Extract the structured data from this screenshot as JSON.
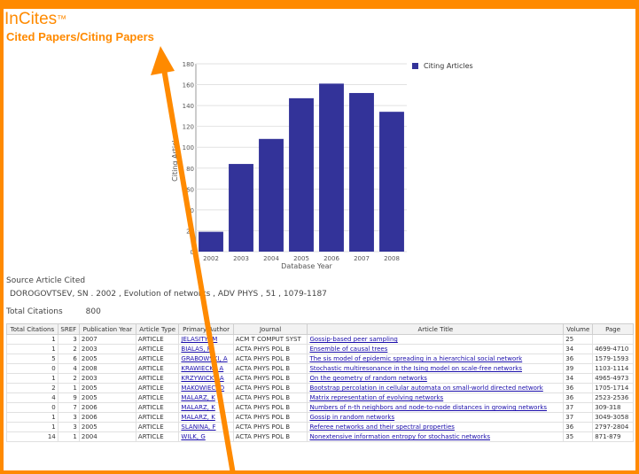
{
  "header": {
    "brand": "InCites",
    "brand_mark": "™",
    "subtitle": "Cited Papers/Citing Papers"
  },
  "chart_data": {
    "type": "bar",
    "categories": [
      "2002",
      "2003",
      "2004",
      "2005",
      "2006",
      "2007",
      "2008"
    ],
    "values": [
      19,
      84,
      108,
      147,
      161,
      152,
      134
    ],
    "ylabel": "Citing Articles",
    "xlabel": "Database Year",
    "yticks": [
      "180",
      "160",
      "140",
      "120",
      "100",
      "80",
      "60",
      "40",
      "20",
      "0"
    ],
    "ylim": [
      0,
      180
    ],
    "legend": "Citing Articles",
    "bar_color": "#333399"
  },
  "source": {
    "heading": "Source Article Cited",
    "line": "DOROGOVTSEV, SN .  2002 ,   Evolution of networks ,   ADV PHYS ,   51 ,   1079-1187",
    "total_label": "Total Citations",
    "total_value": "800"
  },
  "table": {
    "headers": [
      "Total Citations",
      "SREF",
      "Publication Year",
      "Article Type",
      "Primary Author",
      "Journal",
      "Article Title",
      "Volume",
      "Page"
    ],
    "rows": [
      [
        "1",
        "3",
        "2007",
        "ARTICLE",
        "JELASITY, M",
        "ACM T COMPUT SYST",
        "Gossip-based peer sampling",
        "25",
        ""
      ],
      [
        "1",
        "2",
        "2003",
        "ARTICLE",
        "BIALAS, P",
        "ACTA PHYS POL B",
        "Ensemble of causal trees",
        "34",
        "4699-4710"
      ],
      [
        "5",
        "6",
        "2005",
        "ARTICLE",
        "GRABOWSKI, A",
        "ACTA PHYS POL B",
        "The sis model of epidemic spreading in a hierarchical social network",
        "36",
        "1579-1593"
      ],
      [
        "0",
        "4",
        "2008",
        "ARTICLE",
        "KRAWIECKI, A",
        "ACTA PHYS POL B",
        "Stochastic multiresonance in the Ising model on scale-free networks",
        "39",
        "1103-1114"
      ],
      [
        "1",
        "2",
        "2003",
        "ARTICLE",
        "KRZYWICKI, A",
        "ACTA PHYS POL B",
        "On the geometry of random networks",
        "34",
        "4965-4973"
      ],
      [
        "2",
        "1",
        "2005",
        "ARTICLE",
        "MAKOWIEC, D",
        "ACTA PHYS POL B",
        "Bootstrap percolation in cellular automata on small-world directed network",
        "36",
        "1705-1714"
      ],
      [
        "4",
        "9",
        "2005",
        "ARTICLE",
        "MALARZ, K",
        "ACTA PHYS POL B",
        "Matrix representation of evolving networks",
        "36",
        "2523-2536"
      ],
      [
        "0",
        "7",
        "2006",
        "ARTICLE",
        "MALARZ, K",
        "ACTA PHYS POL B",
        "Numbers of n-th neighbors and node-to-node distances in growing networks",
        "37",
        "309-318"
      ],
      [
        "1",
        "3",
        "2006",
        "ARTICLE",
        "MALARZ, K",
        "ACTA PHYS POL B",
        "Gossip in random networks",
        "37",
        "3049-3058"
      ],
      [
        "1",
        "3",
        "2005",
        "ARTICLE",
        "SLANINA, F",
        "ACTA PHYS POL B",
        "Referee networks and their spectral properties",
        "36",
        "2797-2804"
      ],
      [
        "14",
        "1",
        "2004",
        "ARTICLE",
        "WILK, G",
        "ACTA PHYS POL B",
        "Nonextensive information entropy for stochastic networks",
        "35",
        "871-879"
      ]
    ]
  },
  "colors": {
    "accent": "#ff8a00",
    "bar": "#333399",
    "link": "#1a0dab"
  }
}
